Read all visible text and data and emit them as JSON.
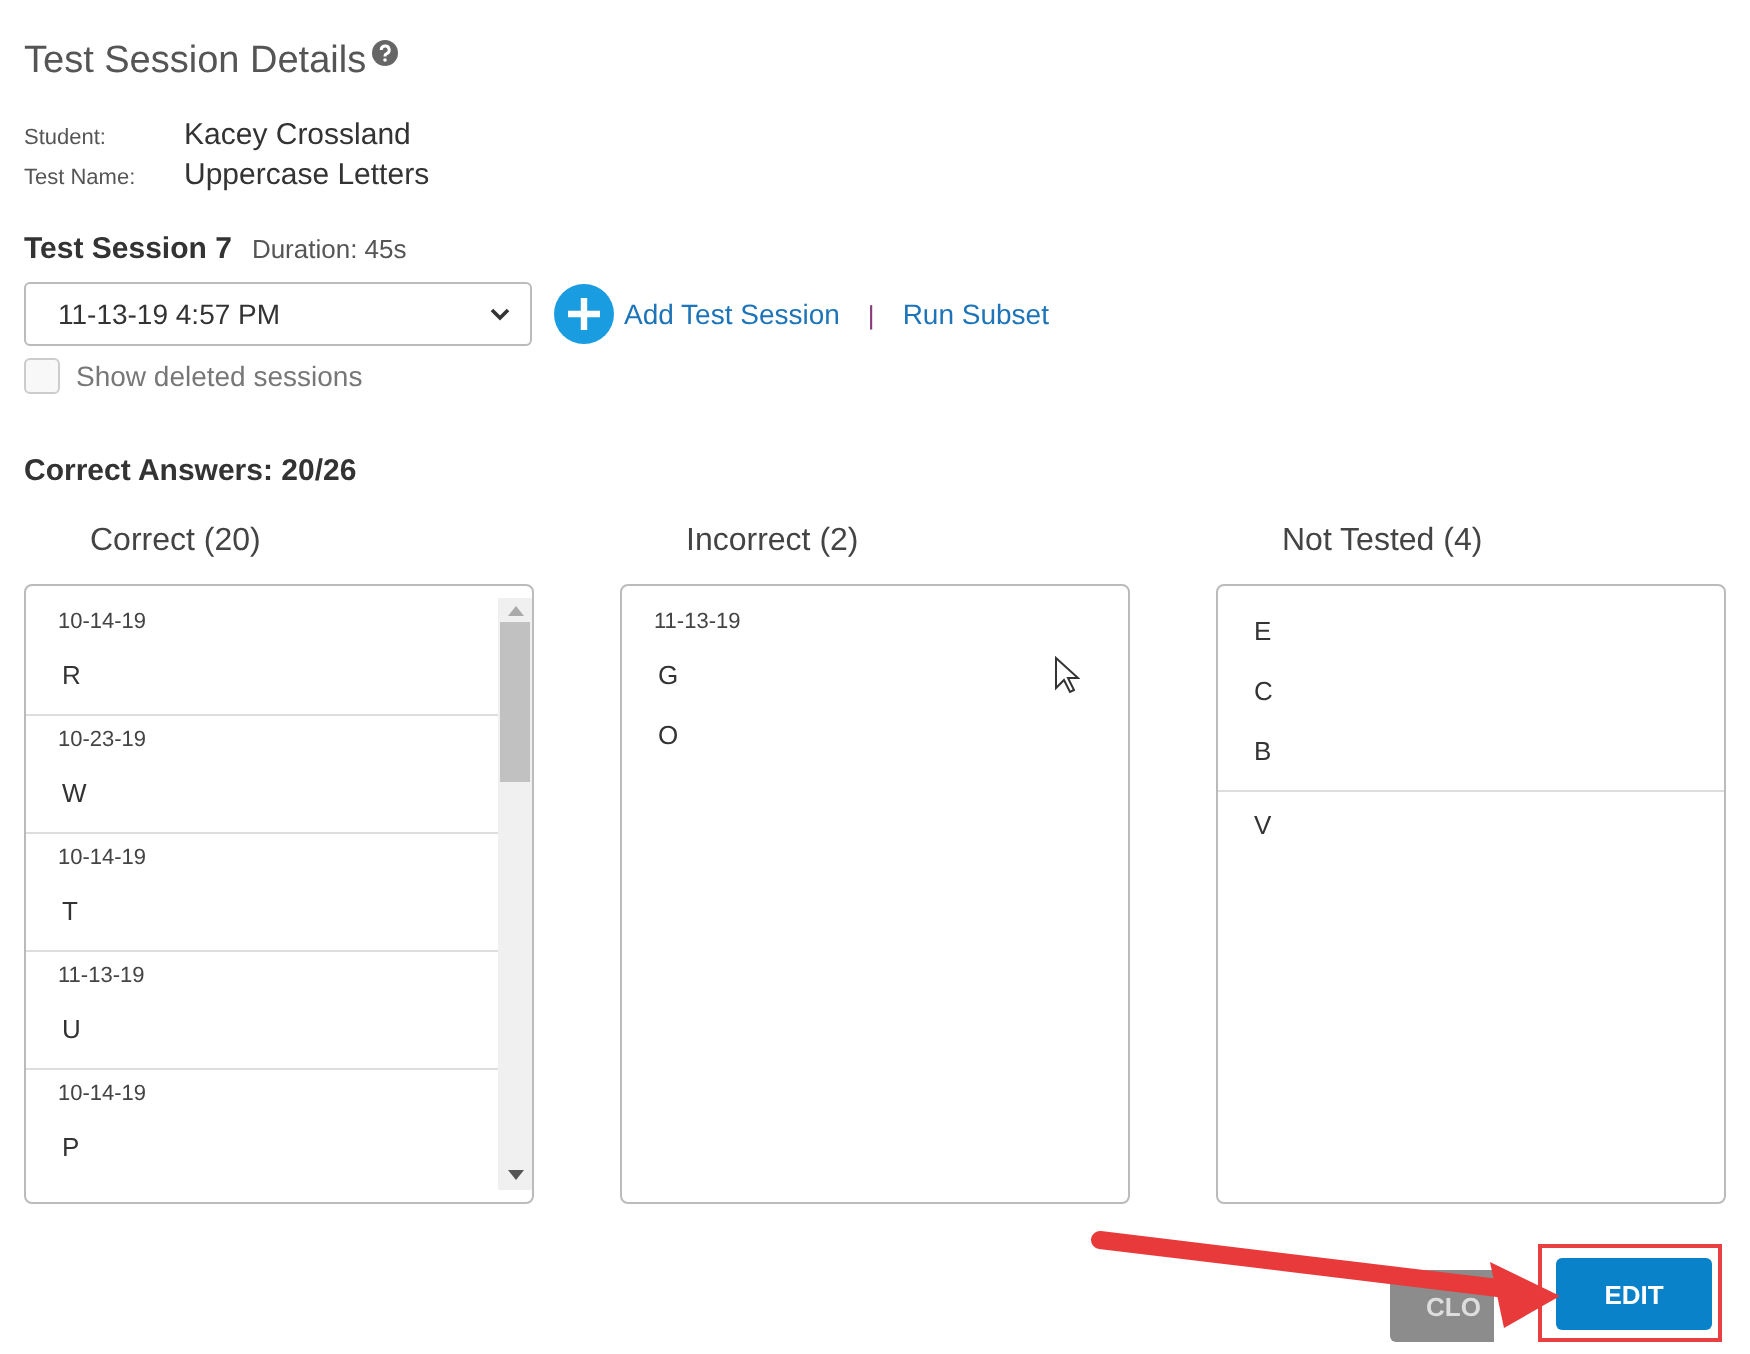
{
  "title": "Test Session Details",
  "fields": [
    {
      "label": "Student:",
      "value": "Kacey Crossland"
    },
    {
      "label": "Test Name:",
      "value": "Uppercase Letters"
    }
  ],
  "session": {
    "title": "Test Session 7",
    "duration": "Duration: 45s",
    "selected_date": "11-13-19 4:57 PM",
    "add_link": "Add Test Session",
    "separator": "|",
    "subset_link": "Run Subset"
  },
  "show_deleted": {
    "label": "Show deleted sessions",
    "checked": false
  },
  "summary": "Correct Answers: 20/26",
  "columns": [
    {
      "heading": "Correct (20)",
      "scrollbar": true,
      "groups": [
        {
          "date": "10-14-19",
          "items": [
            "R"
          ]
        },
        {
          "date": "10-23-19",
          "items": [
            "W"
          ]
        },
        {
          "date": "10-14-19",
          "items": [
            "T"
          ]
        },
        {
          "date": "11-13-19",
          "items": [
            "U"
          ]
        },
        {
          "date": "10-14-19",
          "items": [
            "P"
          ]
        }
      ]
    },
    {
      "heading": "Incorrect (2)",
      "scrollbar": false,
      "groups": [
        {
          "date": "11-13-19",
          "items": [
            "G",
            "O"
          ]
        }
      ]
    },
    {
      "heading": "Not Tested (4)",
      "scrollbar": false,
      "groups": [
        {
          "items": [
            "E",
            "C",
            "B"
          ]
        },
        {
          "items": [
            "V"
          ]
        }
      ]
    }
  ],
  "buttons": [
    {
      "label": "CLO",
      "kind": "secondary"
    },
    {
      "label": "EDIT",
      "kind": "primary"
    }
  ]
}
